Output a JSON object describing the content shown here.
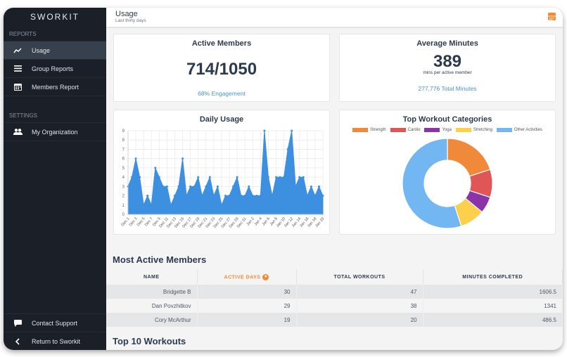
{
  "app": {
    "logo": "SWORKIT"
  },
  "sidebar": {
    "reports_label": "REPORTS",
    "settings_label": "SETTINGS",
    "items": [
      {
        "label": "Usage",
        "icon": "trend-line-icon",
        "active": true
      },
      {
        "label": "Group Reports",
        "icon": "list-icon",
        "active": false
      },
      {
        "label": "Members Report",
        "icon": "calendar-icon",
        "active": false
      }
    ],
    "settings_items": [
      {
        "label": "My Organization",
        "icon": "users-icon"
      }
    ],
    "bottom_items": [
      {
        "label": "Contact Support",
        "icon": "chat-bubble-icon"
      },
      {
        "label": "Return to Sworkit",
        "icon": "chevron-left-icon"
      }
    ]
  },
  "header": {
    "title": "Usage",
    "subtitle": "Last thirty days",
    "calendar_icon": "calendar-icon"
  },
  "active_members": {
    "title": "Active Members",
    "value": "714/1050",
    "link": "68% Engagement"
  },
  "average_minutes": {
    "title": "Average Minutes",
    "value": "389",
    "unit": "mins per active member",
    "link": "277,776 Total Minutes"
  },
  "colors": {
    "accent": "#f08a33",
    "link": "#4a90d9",
    "area": "#3d8fe0",
    "sidebar": "#1b2028"
  },
  "chart_data": [
    {
      "type": "area",
      "title": "Daily Usage",
      "xlabel": "",
      "ylabel": "",
      "ylim": [
        0,
        9
      ],
      "yticks": [
        0,
        1,
        2,
        3,
        4,
        5,
        6,
        7,
        8,
        9
      ],
      "grid": true,
      "x": [
        "Dec 1",
        "Dec 2",
        "Dec 3",
        "Dec 4",
        "Dec 5",
        "Dec 6",
        "Dec 7",
        "Dec 8",
        "Dec 9",
        "Dec 10",
        "Dec 11",
        "Dec 12",
        "Dec 13",
        "Dec 14",
        "Dec 15",
        "Dec 16",
        "Dec 17",
        "Dec 18",
        "Dec 19",
        "Dec 20",
        "Dec 21",
        "Dec 22",
        "Dec 23",
        "Dec 24",
        "Dec 25",
        "Dec 26",
        "Dec 27",
        "Dec 28",
        "Dec 29",
        "Dec 30",
        "Dec 31",
        "Jan 1",
        "Jan 2",
        "Jan 3",
        "Jan 4",
        "Jan 5",
        "Jan 6",
        "Jan 7",
        "Jan 8",
        "Jan 9",
        "Jan 10",
        "Jan 11",
        "Jan 12",
        "Jan 13",
        "Jan 14",
        "Jan 15",
        "Jan 16",
        "Jan 17",
        "Jan 18",
        "Jan 19",
        "Jan 20"
      ],
      "xtick_labels": [
        "Dec 1",
        "Dec 3",
        "Dec 5",
        "Dec 7",
        "Dec 9",
        "Dec 11",
        "Dec 13",
        "Dec 15",
        "Dec 17",
        "Dec 19",
        "Dec 21",
        "Dec 23",
        "Dec 25",
        "Dec 27",
        "Dec 29",
        "Dec 31",
        "Jan 2",
        "Jan 4",
        "Jan 6",
        "Jan 8",
        "Jan 10",
        "Jan 12",
        "Jan 14",
        "Jan 16",
        "Jan 18",
        "Jan 20"
      ],
      "values": [
        3,
        4,
        6,
        4,
        1,
        2,
        1,
        5,
        4,
        3,
        3,
        1,
        2,
        3,
        6,
        2,
        3,
        3,
        4,
        2,
        3,
        4,
        2,
        3,
        1,
        2,
        2,
        3,
        4,
        2,
        2,
        3,
        2,
        2,
        2,
        9,
        4,
        2,
        4,
        4,
        4,
        7,
        9,
        3,
        4,
        4,
        2,
        3,
        2,
        3,
        2
      ],
      "color": "#3d8fe0"
    },
    {
      "type": "pie",
      "title": "Top Workout Categories",
      "legend": "top",
      "labels": [
        "Strength",
        "Cardio",
        "Yoga",
        "Stretching",
        "Other Activities"
      ],
      "values": [
        20,
        10,
        6,
        9,
        55
      ],
      "colors": [
        "#f08a3a",
        "#e05555",
        "#8a34a8",
        "#fcd04a",
        "#72b6f2"
      ],
      "donut": true
    }
  ],
  "most_active": {
    "title": "Most Active Members",
    "columns": [
      "NAME",
      "ACTIVE DAYS",
      "TOTAL WORKOUTS",
      "MINUTES COMPLETED"
    ],
    "sorted_column": 1,
    "rows": [
      [
        "Bridgette B",
        "30",
        "47",
        "1606.5"
      ],
      [
        "Dan Povzhitkov",
        "29",
        "38",
        "1341"
      ],
      [
        "Cory McArthur",
        "19",
        "20",
        "486.5"
      ]
    ]
  },
  "top_workouts": {
    "title": "Top 10 Workouts"
  }
}
